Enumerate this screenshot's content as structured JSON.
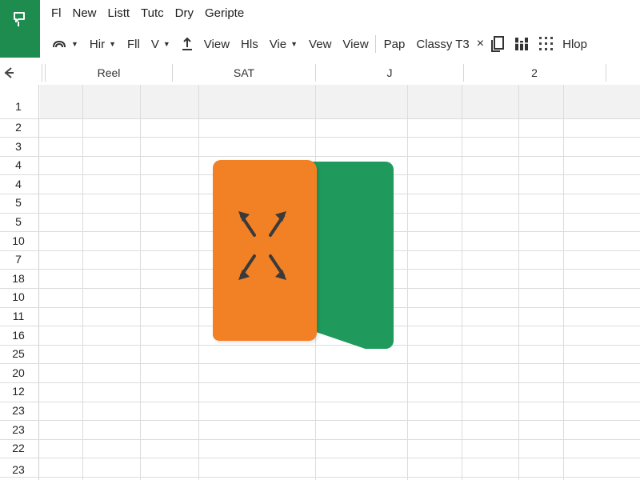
{
  "app": {
    "badge_icon": "spreadsheet-doc-icon",
    "brand_color": "#1e8c4e"
  },
  "menu": [
    "Fl",
    "New",
    "Listt",
    "Tutc",
    "Dry",
    "Geripte"
  ],
  "toolbar": {
    "items": [
      {
        "icon": "cloud-sync-icon",
        "label": "",
        "dropdown": true
      },
      {
        "icon": "",
        "label": "Hir",
        "dropdown": true
      },
      {
        "icon": "",
        "label": "Fll",
        "dropdown": false
      },
      {
        "icon": "",
        "label": "V",
        "dropdown": true
      },
      {
        "icon": "upload-icon",
        "label": "",
        "dropdown": false
      },
      {
        "icon": "",
        "label": "View",
        "dropdown": false
      },
      {
        "icon": "",
        "label": "Hls",
        "dropdown": false
      },
      {
        "icon": "",
        "label": "Vie",
        "dropdown": true
      },
      {
        "icon": "",
        "label": "Vew",
        "dropdown": false
      },
      {
        "icon": "",
        "label": "View",
        "dropdown": false
      }
    ],
    "pap_label": "Pap",
    "doc_label": "Classy T3",
    "close_label": "×",
    "help_label": "Hlop"
  },
  "column_headers": [
    "Reel",
    "SAT",
    "J",
    "2"
  ],
  "row_numbers": [
    "1",
    "2",
    "3",
    "4",
    "4",
    "5",
    "5",
    "10",
    "7",
    "18",
    "10",
    "11",
    "16",
    "25",
    "20",
    "12",
    "23",
    "23",
    "22",
    "23"
  ],
  "logo": {
    "orange": "#f28024",
    "green": "#1f9a5c",
    "icon": "expand-arrows-icon"
  }
}
